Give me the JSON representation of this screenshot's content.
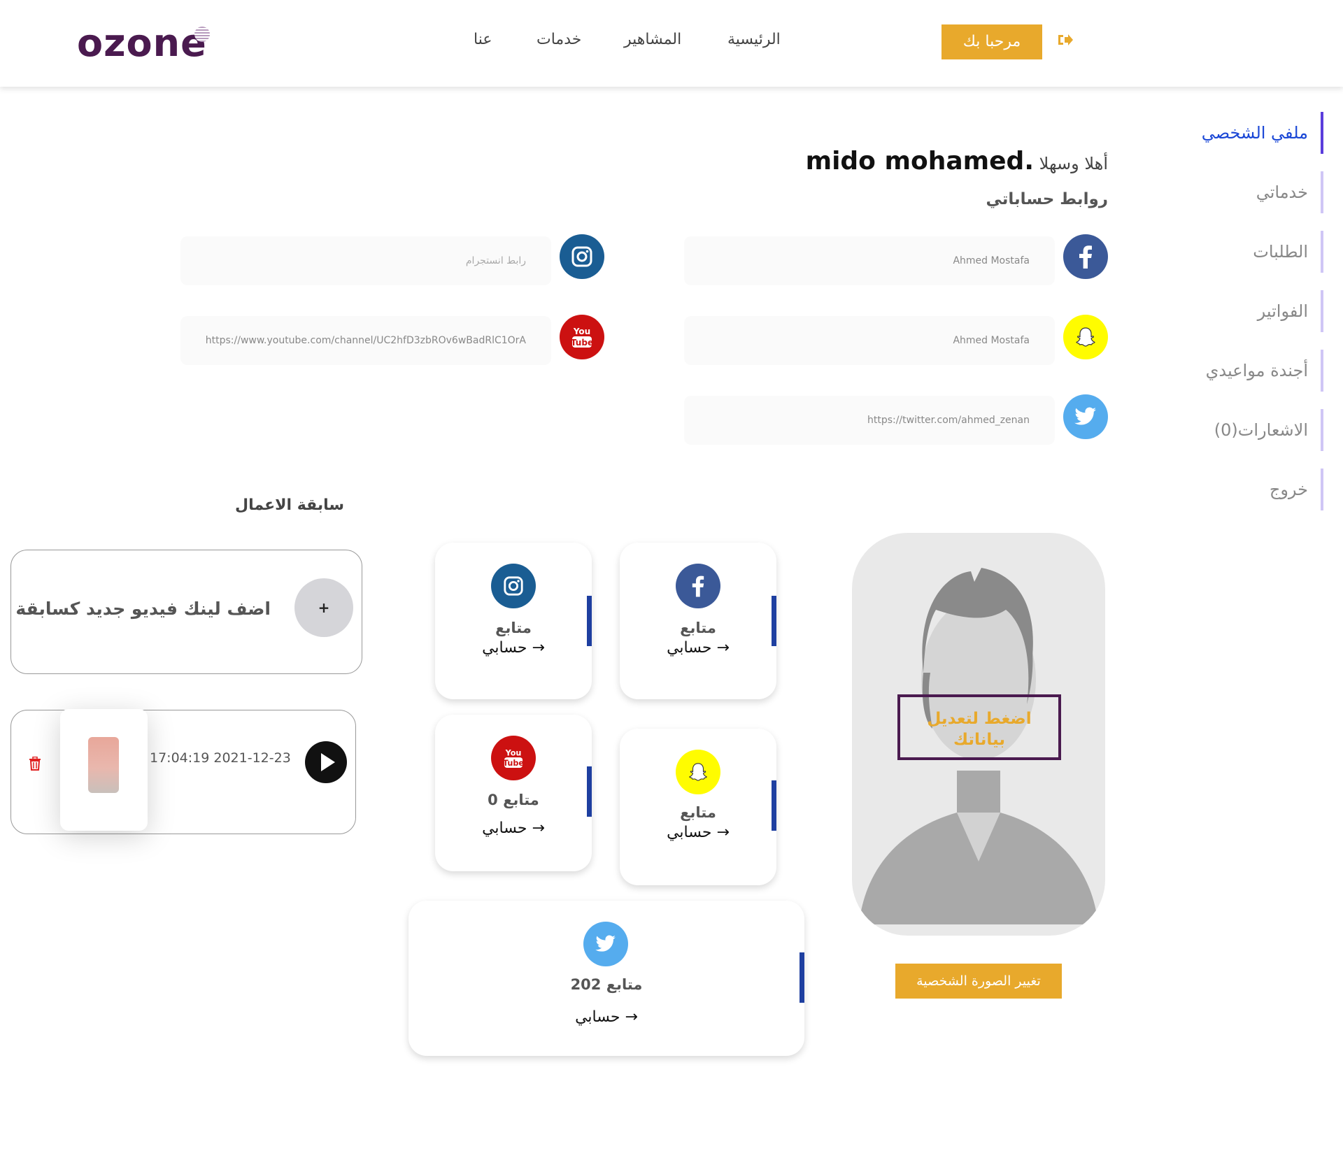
{
  "header": {
    "logo": "ozone",
    "nav": [
      "الرئيسية",
      "المشاهير",
      "خدمات",
      "عنا"
    ],
    "welcome_button": "مرحبا بك"
  },
  "sidebar": {
    "items": [
      {
        "label": "ملفي الشخصي",
        "active": true
      },
      {
        "label": "خدماتي"
      },
      {
        "label": "الطلبات"
      },
      {
        "label": "الفواتير"
      },
      {
        "label": "أجندة مواعيدي"
      },
      {
        "label": "الاشعارات(0)"
      },
      {
        "label": "خروج"
      }
    ]
  },
  "profile": {
    "greeting_prefix": "أهلا وسهلا",
    "user_name": "mido mohamed.",
    "links_title": "روابط حساباتي"
  },
  "links": {
    "facebook": "Ahmed Mostafa",
    "instagram_placeholder": "رابط انستجرام",
    "snapchat": "Ahmed Mostafa",
    "youtube": "https://www.youtube.com/channel/UC2hfD3zbROv6wBadRlC1OrA",
    "twitter": "https://twitter.com/ahmed_zenan"
  },
  "stats": {
    "facebook": {
      "count": "متابع",
      "link": "حسابي →"
    },
    "instagram": {
      "count": "متابع",
      "link": "حسابي →"
    },
    "snapchat": {
      "count": "متابع",
      "link": "حسابي →"
    },
    "youtube": {
      "count": "0 متابع",
      "link": "حسابي →"
    },
    "twitter": {
      "count": "202 متابع",
      "link": "حسابي →"
    }
  },
  "avatar": {
    "edit_overlay": "اضغط لتعديل بياناتك",
    "change_photo_button": "تغيير الصورة الشخصية"
  },
  "works": {
    "title": "سابقة الاعمال",
    "add_label": "اضف لينك فيديو جديد كسابقة",
    "add_button": "+",
    "video_date": "17:04:19 2021-12-23"
  },
  "colors": {
    "accent": "#e8a92c",
    "brand": "#4a1a4f",
    "active_link": "#1a47d6"
  }
}
